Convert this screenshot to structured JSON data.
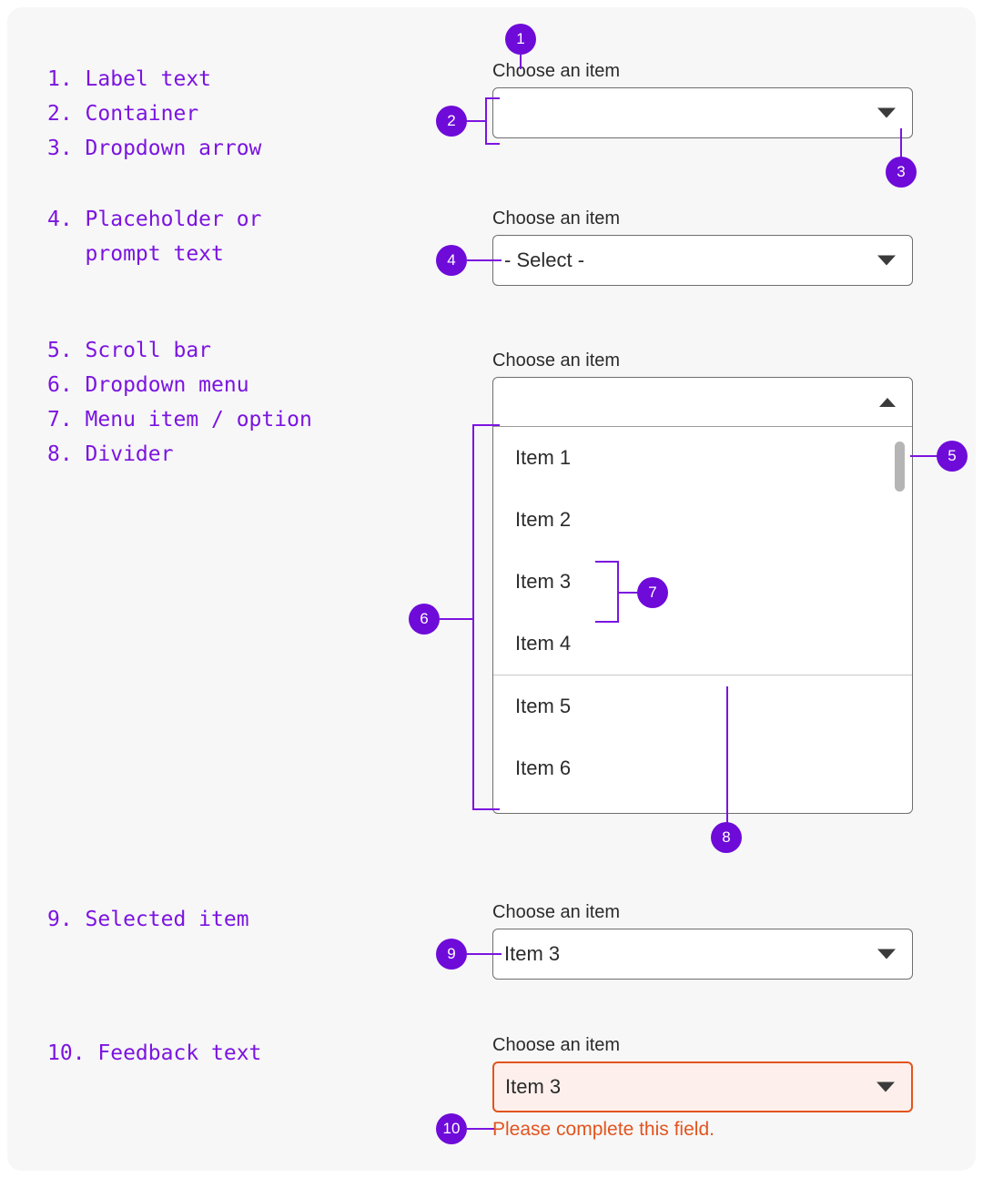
{
  "legend": {
    "lines": [
      "1. Label text",
      "2. Container",
      "3. Dropdown arrow",
      "4. Placeholder or",
      "   prompt text",
      "5. Scroll bar",
      "6. Dropdown menu",
      "7. Menu item / option",
      "8. Divider",
      "9. Selected item",
      "10. Feedback text"
    ],
    "block1": "1. Label text\n2. Container\n3. Dropdown arrow",
    "block2": "4. Placeholder or\n   prompt text",
    "block3": "5. Scroll bar\n6. Dropdown menu\n7. Menu item / option\n8. Divider",
    "block4": "9. Selected item",
    "block5": "10. Feedback text"
  },
  "fields": {
    "empty": {
      "label": "Choose an item",
      "value": "",
      "caret": "caret-down-icon"
    },
    "placeholder": {
      "label": "Choose an item",
      "value": "- Select -",
      "caret": "caret-down-icon"
    },
    "open": {
      "label": "Choose an item",
      "value": "",
      "caret": "caret-up-icon",
      "items": [
        "Item 1",
        "Item 2",
        "Item 3",
        "Item 4",
        "Item 5",
        "Item 6"
      ],
      "divider_after_index": 3
    },
    "selected": {
      "label": "Choose an item",
      "value": "Item 3",
      "caret": "caret-down-icon"
    },
    "feedback": {
      "label": "Choose an item",
      "value": "Item 3",
      "caret": "caret-down-icon",
      "message": "Please complete this field."
    }
  },
  "badges": {
    "b1": "1",
    "b2": "2",
    "b3": "3",
    "b4": "4",
    "b5": "5",
    "b6": "6",
    "b7": "7",
    "b8": "8",
    "b9": "9",
    "b10": "10"
  },
  "colors": {
    "accent_purple": "#7B14E0",
    "badge_purple": "#6E0BD9",
    "error": "#E2541E",
    "error_bg": "#fdf0ec",
    "canvas_bg": "#f7f7f7",
    "field_border": "#6e6e6e",
    "scrollbar": "#b5b5b5"
  }
}
